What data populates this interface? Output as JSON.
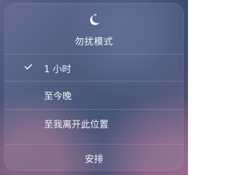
{
  "header": {
    "icon": "moon-icon",
    "title": "勿扰模式"
  },
  "options": [
    {
      "label": "1 小时",
      "selected": true
    },
    {
      "label": "至今晚",
      "selected": false
    },
    {
      "label": "至我离开此位置",
      "selected": false
    }
  ],
  "footer": {
    "label": "安排"
  },
  "colors": {
    "text": "#f6f6fa",
    "panel": "rgba(150,160,185,0.18)"
  }
}
